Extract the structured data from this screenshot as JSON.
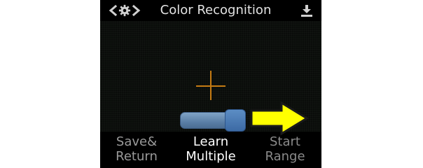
{
  "window": {
    "title": "Color Recognition"
  },
  "header": {
    "back_icon": "chevron-left-icon",
    "settings_icon": "gear-icon",
    "forward_icon": "chevron-right-icon",
    "download_icon": "download-icon"
  },
  "viewer": {
    "crosshair_icon": "crosshair-icon"
  },
  "slider": {
    "value_percent": 100,
    "colors": {
      "track": "#6b8fb6",
      "thumb": "#4a7ab4"
    }
  },
  "menu": {
    "items": [
      {
        "line1": "Save&",
        "line2": "Return"
      },
      {
        "line1": "Learn",
        "line2": "Multiple"
      },
      {
        "line1": "Start",
        "line2": "Range"
      }
    ],
    "active_index": 1
  },
  "colors": {
    "crosshair": "#c47a12",
    "arrow_fill": "#ffff00",
    "arrow_stroke": "#1a1a1a"
  }
}
